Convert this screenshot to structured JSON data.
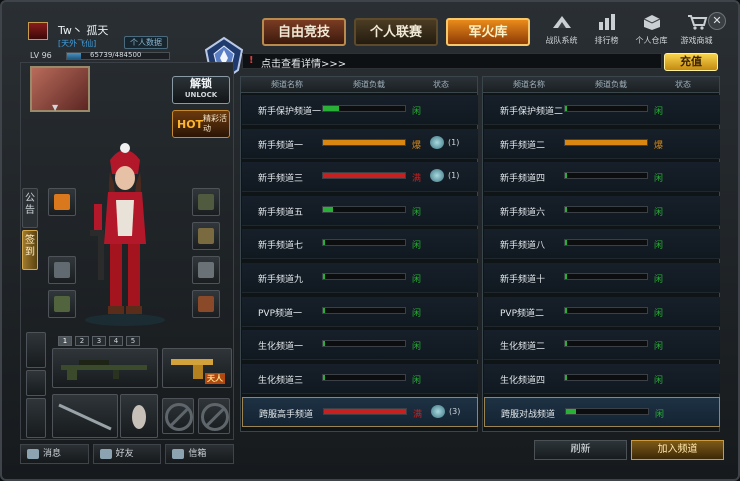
{
  "profile": {
    "name": "Tw丶 孤天",
    "clan": "[天外飞仙]",
    "info_button": "个人数据",
    "level": "LV 96",
    "exp_text": "65739/484500",
    "exp_progress": 0.136,
    "badge_label": "LV.96"
  },
  "tabs": [
    {
      "label": "自由竞技",
      "state": "free"
    },
    {
      "label": "个人联赛",
      "state": "normal"
    },
    {
      "label": "军火库",
      "state": "active"
    }
  ],
  "topnav": [
    {
      "label": "战队系统",
      "icon": "team-icon"
    },
    {
      "label": "排行榜",
      "icon": "ranking-icon"
    },
    {
      "label": "个人仓库",
      "icon": "warehouse-icon"
    },
    {
      "label": "游戏商城",
      "icon": "shop-cart-icon"
    }
  ],
  "close_glyph": "✕",
  "notice": {
    "mark": "!",
    "text": "点击查看详情>>>"
  },
  "recharge_label": "充值",
  "unlock": {
    "cn": "解锁",
    "en": "UNLOCK"
  },
  "hot": {
    "tag": "HOT",
    "text": "精彩活动"
  },
  "side_tabs": {
    "announce": "公告",
    "sign": "签到"
  },
  "weapon_tabs": [
    "1",
    "2",
    "3",
    "4",
    "5"
  ],
  "weapon_tag": "天人",
  "bottom_left": [
    {
      "label": "消息",
      "icon": "message-icon"
    },
    {
      "label": "好友",
      "icon": "friends-icon"
    },
    {
      "label": "信箱",
      "icon": "mail-icon"
    }
  ],
  "colors": {
    "green": "#29b036",
    "orange": "#d98710",
    "red": "#c62020"
  },
  "channels_left": {
    "headers": [
      "频道名称",
      "频道负载",
      "状态"
    ],
    "rows": [
      {
        "name": "新手保护频道一",
        "load": 0.2,
        "color": "green",
        "status": "闲",
        "vip": ""
      },
      {
        "name": "新手频道一",
        "load": 1.0,
        "color": "orange",
        "status": "爆",
        "vip": "(1)"
      },
      {
        "name": "新手频道三",
        "load": 1.0,
        "color": "red",
        "status": "满",
        "vip": "(1)"
      },
      {
        "name": "新手频道五",
        "load": 0.12,
        "color": "green",
        "status": "闲",
        "vip": ""
      },
      {
        "name": "新手频道七",
        "load": 0.02,
        "color": "green",
        "status": "闲",
        "vip": ""
      },
      {
        "name": "新手频道九",
        "load": 0.02,
        "color": "green",
        "status": "闲",
        "vip": ""
      },
      {
        "name": "PVP频道一",
        "load": 0.02,
        "color": "green",
        "status": "闲",
        "vip": ""
      },
      {
        "name": "生化频道一",
        "load": 0.02,
        "color": "green",
        "status": "闲",
        "vip": ""
      },
      {
        "name": "生化频道三",
        "load": 0.02,
        "color": "green",
        "status": "闲",
        "vip": ""
      },
      {
        "name": "跨服高手频道",
        "load": 1.0,
        "color": "red",
        "status": "满",
        "vip": "(3)"
      }
    ]
  },
  "channels_right": {
    "headers": [
      "频道名称",
      "频道负载",
      "状态"
    ],
    "rows": [
      {
        "name": "新手保护频道二",
        "load": 0.02,
        "color": "green",
        "status": "闲"
      },
      {
        "name": "新手频道二",
        "load": 1.0,
        "color": "orange",
        "status": "爆"
      },
      {
        "name": "新手频道四",
        "load": 0.02,
        "color": "green",
        "status": "闲"
      },
      {
        "name": "新手频道六",
        "load": 0.02,
        "color": "green",
        "status": "闲"
      },
      {
        "name": "新手频道八",
        "load": 0.02,
        "color": "green",
        "status": "闲"
      },
      {
        "name": "新手频道十",
        "load": 0.02,
        "color": "green",
        "status": "闲"
      },
      {
        "name": "PVP频道二",
        "load": 0.02,
        "color": "green",
        "status": "闲"
      },
      {
        "name": "生化频道二",
        "load": 0.02,
        "color": "green",
        "status": "闲"
      },
      {
        "name": "生化频道四",
        "load": 0.02,
        "color": "green",
        "status": "闲"
      },
      {
        "name": "跨服对战频道",
        "load": 0.12,
        "color": "green",
        "status": "闲"
      }
    ]
  },
  "refresh_label": "刷新",
  "join_label": "加入频道"
}
